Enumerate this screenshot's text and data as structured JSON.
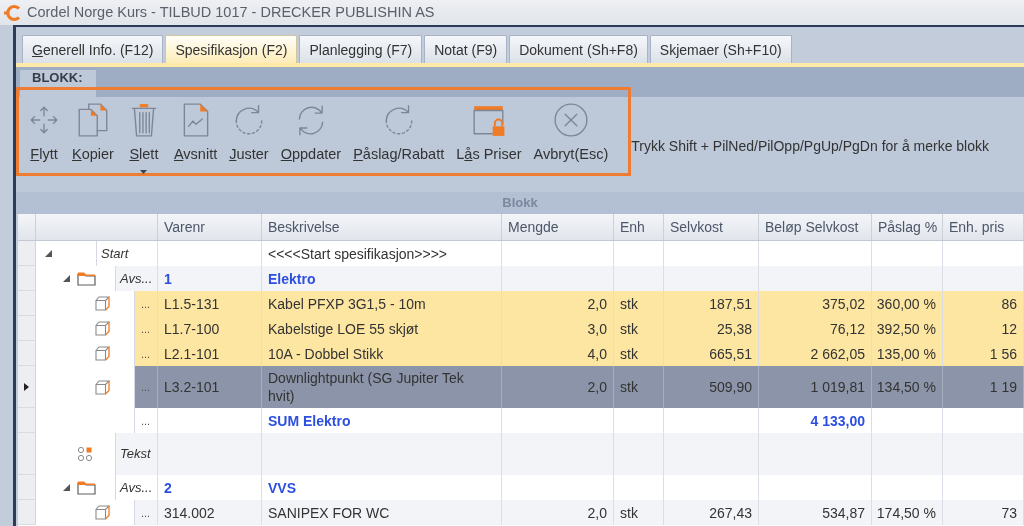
{
  "window": {
    "title": "Cordel Norge Kurs - TILBUD 1017 - DRECKER PUBLISHIN AS"
  },
  "tabs": [
    {
      "hotkey": "G",
      "text": "enerell Info. (F12)",
      "selected": false
    },
    {
      "text": "Spesifikasjon (F2)",
      "selected": true
    },
    {
      "text": "Planlegging (F7)",
      "selected": false
    },
    {
      "text": "Notat (F9)",
      "selected": false
    },
    {
      "text": "Dokument (Sh+F8)",
      "selected": false
    },
    {
      "text": "Skjemaer (Sh+F10)",
      "selected": false
    }
  ],
  "ribbon": {
    "page_tab": "BLOKK:",
    "highlighted": true,
    "buttons": [
      {
        "kind": "move",
        "hotkey": "F",
        "text": "lytt",
        "dropdown": false
      },
      {
        "kind": "copy",
        "hotkey": "K",
        "text": "opier",
        "dropdown": false
      },
      {
        "kind": "delete",
        "hotkey": "S",
        "text": "lett",
        "dropdown": true
      },
      {
        "kind": "section",
        "hotkey": "A",
        "text": "vsnitt",
        "dropdown": false
      },
      {
        "kind": "adjust",
        "hotkey": "J",
        "text": "uster",
        "dropdown": false
      },
      {
        "kind": "update",
        "hotkey": "O",
        "text": "ppdater",
        "dropdown": false
      },
      {
        "kind": "markup",
        "hotkey": "P",
        "text": "åslag/Rabatt",
        "dropdown": false
      },
      {
        "kind": "lock",
        "prefix": "L",
        "hotkey": "å",
        "text": "s Priser",
        "dropdown": false
      },
      {
        "kind": "cancel",
        "text": "Avbryt(Esc)",
        "dropdown": false
      }
    ],
    "hint": "Trykk Shift + PilNed/PilOpp/PgUp/PgDn for å merke blokk"
  },
  "grid": {
    "group_title": "Blokk",
    "columns": [
      "Varenr",
      "Beskrivelse",
      "Mengde",
      "Enh",
      "Selvkost",
      "Beløp Selvkost",
      "Påslag %",
      "Enh. pris"
    ],
    "rows": [
      {
        "kind": "start",
        "label": "Start",
        "description": "<<<<Start spesifikasjon>>>>",
        "expanded": true,
        "selected": false,
        "focused": false,
        "children": [
          {
            "kind": "section",
            "label": "Avs...",
            "varenr": "1",
            "description": "Elektro",
            "expanded": true,
            "selected": false,
            "focused": false,
            "children": [
              {
                "kind": "item",
                "dots": "...",
                "varenr": "L1.5-131",
                "description": "Kabel PFXP 3G1,5 - 10m",
                "quantity": "2,0",
                "unit": "stk",
                "cost": "187,51",
                "cost_total": "375,02",
                "markup": "360,00 %",
                "unit_price": "86",
                "selected": true,
                "focused": false
              },
              {
                "kind": "item",
                "dots": "...",
                "varenr": "L1.7-100",
                "description": "Kabelstige LOE 55 skjøt",
                "quantity": "3,0",
                "unit": "stk",
                "cost": "25,38",
                "cost_total": "76,12",
                "markup": "392,50 %",
                "unit_price": "12",
                "selected": true,
                "focused": false
              },
              {
                "kind": "item",
                "dots": "...",
                "varenr": "L2.1-101",
                "description": "10A - Dobbel Stikk",
                "quantity": "4,0",
                "unit": "stk",
                "cost": "665,51",
                "cost_total": "2 662,05",
                "markup": "135,00 %",
                "unit_price": "1 56",
                "selected": true,
                "focused": false
              },
              {
                "kind": "item",
                "dots": "...",
                "varenr": "L3.2-101",
                "description": "Downlightpunkt (SG Jupiter Tek hvit)",
                "quantity": "2,0",
                "unit": "stk",
                "cost": "509,90",
                "cost_total": "1 019,81",
                "markup": "134,50 %",
                "unit_price": "1 19",
                "selected": false,
                "focused": true
              },
              {
                "kind": "sum",
                "dots": "...",
                "description": "SUM Elektro",
                "cost_total": "4 133,00",
                "selected": false,
                "focused": false
              }
            ]
          },
          {
            "kind": "text",
            "label": "Tekst",
            "selected": false,
            "focused": false
          },
          {
            "kind": "section",
            "label": "Avs...",
            "varenr": "2",
            "description": "VVS",
            "expanded": true,
            "selected": false,
            "focused": false,
            "children": [
              {
                "kind": "item",
                "dots": "...",
                "varenr": "314.002",
                "description": "SANIPEX FOR WC",
                "quantity": "2,0",
                "unit": "stk",
                "cost": "267,43",
                "cost_total": "534,87",
                "markup": "174,50 %",
                "unit_price": "73",
                "selected": false,
                "focused": false
              }
            ]
          }
        ]
      }
    ]
  }
}
